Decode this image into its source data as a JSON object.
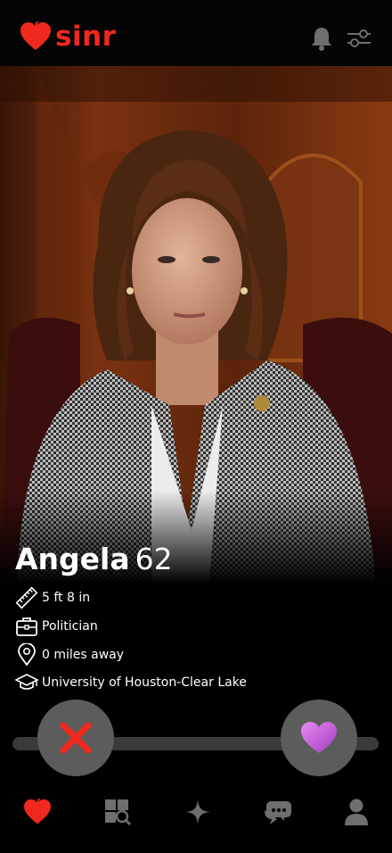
{
  "app": {
    "brand": "sinr",
    "accent_color": "#f0281e"
  },
  "header": {
    "notifications_icon": "bell-icon",
    "filters_icon": "sliders-icon"
  },
  "profile": {
    "name": "Angela",
    "age": "62",
    "details": [
      {
        "icon": "ruler-icon",
        "text": "5 ft 8 in"
      },
      {
        "icon": "briefcase-icon",
        "text": "Politician"
      },
      {
        "icon": "location-pin-icon",
        "text": "0 miles away"
      },
      {
        "icon": "graduation-cap-icon",
        "text": "University of Houston-Clear Lake"
      }
    ]
  },
  "actions": {
    "nope_icon": "x-icon",
    "like_icon": "heart-icon",
    "nope_color": "#f0281e",
    "like_color": "#c04fd0"
  },
  "nav": {
    "items": [
      {
        "icon": "heart-icon",
        "active": true
      },
      {
        "icon": "explore-grid-icon",
        "active": false
      },
      {
        "icon": "sparkle-icon",
        "active": false
      },
      {
        "icon": "chat-bubbles-icon",
        "active": false
      },
      {
        "icon": "profile-icon",
        "active": false
      }
    ]
  }
}
